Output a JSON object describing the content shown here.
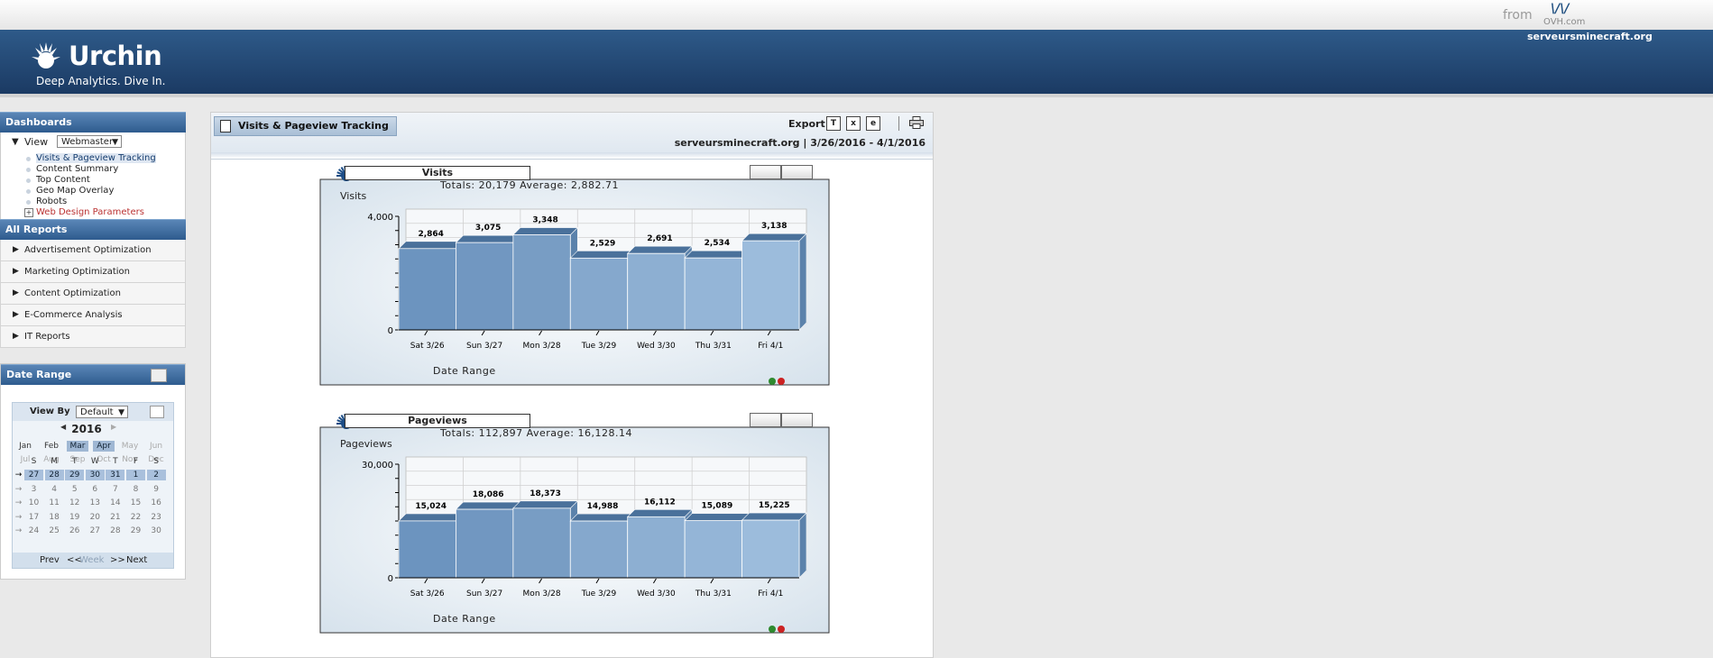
{
  "top": {
    "from": "from",
    "ovh_mark": "\\/\\/",
    "ovh_text": "OVH.com"
  },
  "header": {
    "logo_name": "Urchin",
    "tagline": "Deep Analytics. Dive In.",
    "site": "serveursminecraft.org"
  },
  "sidebar": {
    "dashboards_title": "Dashboards",
    "view_label": "View",
    "view_select": "Webmaster",
    "dashboards": [
      "Visits & Pageview Tracking",
      "Content Summary",
      "Top Content",
      "Geo Map Overlay",
      "Robots",
      "Web Design Parameters"
    ],
    "all_reports_title": "All Reports",
    "reports": [
      "Advertisement Optimization",
      "Marketing Optimization",
      "Content Optimization",
      "E-Commerce Analysis",
      "IT Reports"
    ]
  },
  "date_panel": {
    "title": "Date Range",
    "view_by_label": "View By",
    "view_by_value": "Default",
    "year": "2016",
    "months": [
      "Jan",
      "Feb",
      "Mar",
      "Apr",
      "May",
      "Jun",
      "Jul",
      "Aug",
      "Sep",
      "Oct",
      "Nov",
      "Dec"
    ],
    "weekdays": [
      "S",
      "M",
      "T",
      "W",
      "T",
      "F",
      "S"
    ],
    "weeks": [
      [
        "27",
        "28",
        "29",
        "30",
        "31",
        "1",
        "2"
      ],
      [
        "3",
        "4",
        "5",
        "6",
        "7",
        "8",
        "9"
      ],
      [
        "10",
        "11",
        "12",
        "13",
        "14",
        "15",
        "16"
      ],
      [
        "17",
        "18",
        "19",
        "20",
        "21",
        "22",
        "23"
      ],
      [
        "24",
        "25",
        "26",
        "27",
        "28",
        "29",
        "30"
      ]
    ],
    "prev": "Prev",
    "week": "Week",
    "next": "Next",
    "nav_left": "<<",
    "nav_right": ">>"
  },
  "report": {
    "tab_title": "Visits & Pageview Tracking",
    "export_label": "Export",
    "site_range": "serveursminecraft.org  |  3/26/2016 - 4/1/2016"
  },
  "charts": {
    "visits": {
      "title": "Visits",
      "totals": "Totals: 20,179    Average: 2,882.71",
      "ylabel": "Visits",
      "xlabel": "Date Range"
    },
    "pageviews": {
      "title": "Pageviews",
      "totals": "Totals: 112,897    Average: 16,128.14",
      "ylabel": "Pageviews",
      "xlabel": "Date Range"
    }
  },
  "chart_data": [
    {
      "type": "bar",
      "title": "Visits",
      "ylabel": "Visits",
      "xlabel": "Date Range",
      "categories": [
        "Sat 3/26",
        "Sun 3/27",
        "Mon 3/28",
        "Tue 3/29",
        "Wed 3/30",
        "Thu 3/31",
        "Fri 4/1"
      ],
      "values": [
        2864,
        3075,
        3348,
        2529,
        2691,
        2534,
        3138
      ],
      "labels": [
        "2,864",
        "3,075",
        "3,348",
        "2,529",
        "2,691",
        "2,534",
        "3,138"
      ],
      "ylim": [
        0,
        4000
      ],
      "yticks": [
        "0",
        "4,000"
      ],
      "colors": [
        "#6c94bf",
        "#7197c1",
        "#789dc4",
        "#85a8cd",
        "#8dafd2",
        "#94b5d7",
        "#9cbcdc"
      ]
    },
    {
      "type": "bar",
      "title": "Pageviews",
      "ylabel": "Pageviews",
      "xlabel": "Date Range",
      "categories": [
        "Sat 3/26",
        "Sun 3/27",
        "Mon 3/28",
        "Tue 3/29",
        "Wed 3/30",
        "Thu 3/31",
        "Fri 4/1"
      ],
      "values": [
        15024,
        18086,
        18373,
        14988,
        16112,
        15089,
        15225
      ],
      "labels": [
        "15,024",
        "18,086",
        "18,373",
        "14,988",
        "16,112",
        "15,089",
        "15,225"
      ],
      "ylim": [
        0,
        30000
      ],
      "yticks": [
        "0",
        "30,000"
      ],
      "colors": [
        "#6c94bf",
        "#7197c1",
        "#789dc4",
        "#85a8cd",
        "#8dafd2",
        "#94b5d7",
        "#9cbcdc"
      ]
    }
  ]
}
